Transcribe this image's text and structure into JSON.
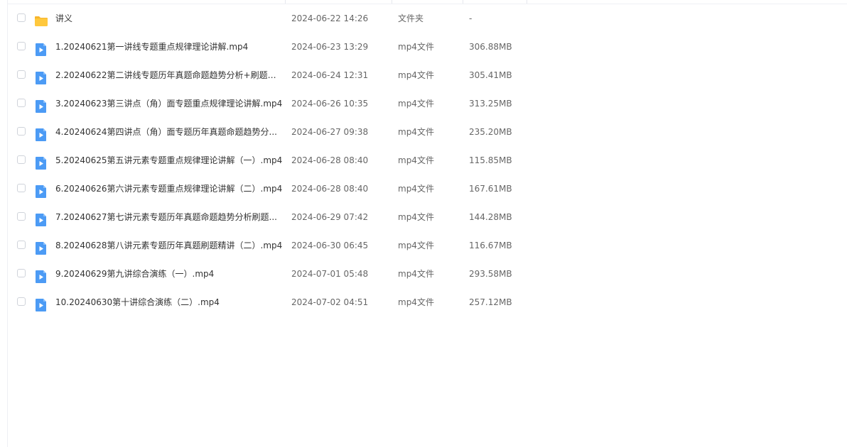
{
  "files": [
    {
      "name": "讲义",
      "date": "2024-06-22 14:26",
      "type": "文件夹",
      "size": "-",
      "icon": "folder-icon"
    },
    {
      "name": "1.20240621第一讲线专题重点规律理论讲解.mp4",
      "date": "2024-06-23 13:29",
      "type": "mp4文件",
      "size": "306.88MB",
      "icon": "video-file-icon"
    },
    {
      "name": "2.20240622第二讲线专题历年真题命题趋势分析+刷题精...",
      "date": "2024-06-24 12:31",
      "type": "mp4文件",
      "size": "305.41MB",
      "icon": "video-file-icon"
    },
    {
      "name": "3.20240623第三讲点（角）面专题重点规律理论讲解.mp4",
      "date": "2024-06-26 10:35",
      "type": "mp4文件",
      "size": "313.25MB",
      "icon": "video-file-icon"
    },
    {
      "name": "4.20240624第四讲点（角）面专题历年真题命题趋势分...",
      "date": "2024-06-27 09:38",
      "type": "mp4文件",
      "size": "235.20MB",
      "icon": "video-file-icon"
    },
    {
      "name": "5.20240625第五讲元素专题重点规律理论讲解（一）.mp4",
      "date": "2024-06-28 08:40",
      "type": "mp4文件",
      "size": "115.85MB",
      "icon": "video-file-icon"
    },
    {
      "name": "6.20240626第六讲元素专题重点规律理论讲解（二）.mp4",
      "date": "2024-06-28 08:40",
      "type": "mp4文件",
      "size": "167.61MB",
      "icon": "video-file-icon"
    },
    {
      "name": "7.20240627第七讲元素专题历年真题命题趋势分析刷题...",
      "date": "2024-06-29 07:42",
      "type": "mp4文件",
      "size": "144.28MB",
      "icon": "video-file-icon"
    },
    {
      "name": "8.20240628第八讲元素专题历年真题刷题精讲（二）.mp4",
      "date": "2024-06-30 06:45",
      "type": "mp4文件",
      "size": "116.67MB",
      "icon": "video-file-icon"
    },
    {
      "name": "9.20240629第九讲综合演练（一）.mp4",
      "date": "2024-07-01 05:48",
      "type": "mp4文件",
      "size": "293.58MB",
      "icon": "video-file-icon"
    },
    {
      "name": "10.20240630第十讲综合演练（二）.mp4",
      "date": "2024-07-02 04:51",
      "type": "mp4文件",
      "size": "257.12MB",
      "icon": "video-file-icon"
    }
  ],
  "colors": {
    "folder": "#FFC83D",
    "folder_tab": "#F7B52C",
    "video": "#4C9BF5",
    "text": "#333333",
    "muted": "#666666"
  }
}
